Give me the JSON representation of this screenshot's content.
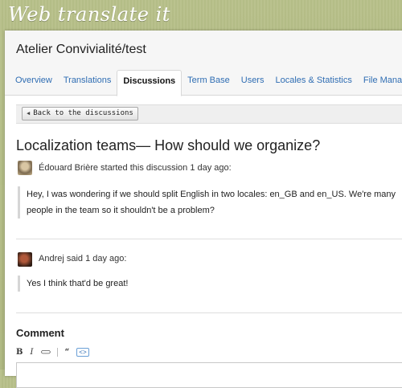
{
  "app": {
    "logo_text": "Web translate it"
  },
  "project": {
    "title": "Atelier Convivialité/test"
  },
  "tabs": [
    {
      "label": "Overview"
    },
    {
      "label": "Translations"
    },
    {
      "label": "Discussions"
    },
    {
      "label": "Term Base"
    },
    {
      "label": "Users"
    },
    {
      "label": "Locales & Statistics"
    },
    {
      "label": "File Manager"
    }
  ],
  "active_tab": "Discussions",
  "toolbar": {
    "back_label": "Back to the discussions"
  },
  "discussion": {
    "title": "Localization teams— How should we organize?",
    "messages": [
      {
        "meta": "Édouard Brière started this discussion 1 day ago:",
        "body": "Hey, I was wondering if we should split English in two locales: en_GB and en_US. We're many people in the team so it shouldn't be a problem?"
      },
      {
        "meta": "Andrej said 1 day ago:",
        "body": "Yes I think that'd be great!"
      }
    ]
  },
  "comment": {
    "heading": "Comment",
    "editor_tools": {
      "bold": "B",
      "italic": "I",
      "link": "⊂⊃",
      "quote": "“",
      "code": "<>"
    }
  },
  "icons": {
    "back": "triangle-left-icon",
    "bold": "bold-icon",
    "italic": "italic-icon",
    "link": "link-icon",
    "quote": "quote-icon",
    "code": "code-icon"
  },
  "colors": {
    "background": "#b4bd84",
    "link": "#2f6db3"
  }
}
